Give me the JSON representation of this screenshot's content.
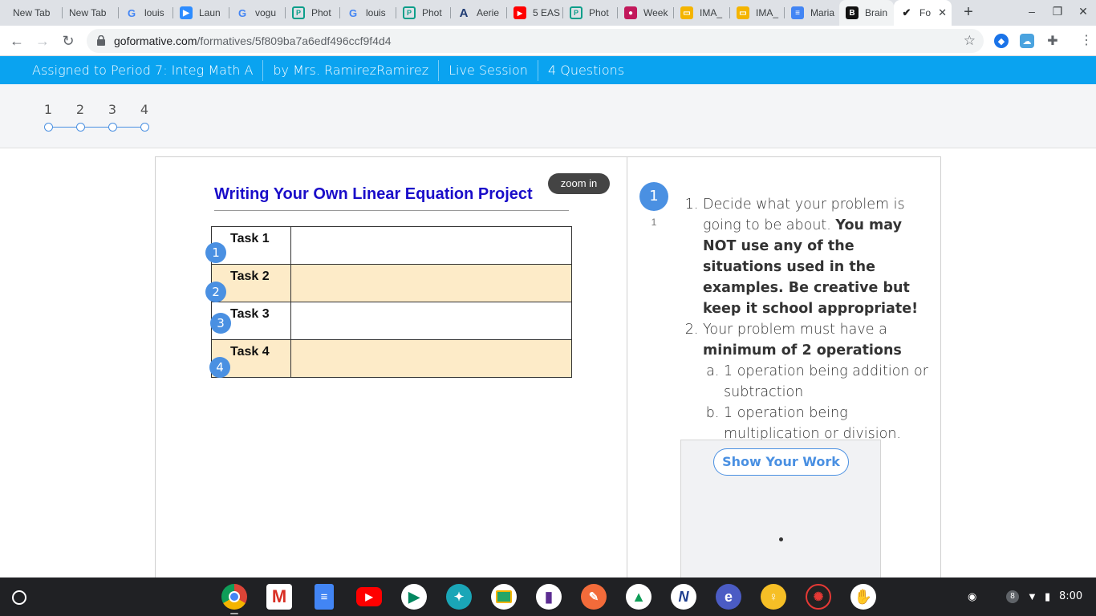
{
  "browser": {
    "tabs": [
      {
        "label": "New Tab",
        "icon": "none"
      },
      {
        "label": "New Tab",
        "icon": "none"
      },
      {
        "label": "louis",
        "icon": "google-icon"
      },
      {
        "label": "Laun",
        "icon": "zoom-icon"
      },
      {
        "label": "vogu",
        "icon": "google-icon"
      },
      {
        "label": "Phot",
        "icon": "photomath-icon"
      },
      {
        "label": "louis",
        "icon": "google-icon"
      },
      {
        "label": "Phot",
        "icon": "photomath-icon"
      },
      {
        "label": "Aerie",
        "icon": "aerie-icon"
      },
      {
        "label": "5 EAS",
        "icon": "youtube-icon"
      },
      {
        "label": "Phot",
        "icon": "photomath-icon"
      },
      {
        "label": "Week",
        "icon": "classroom-icon"
      },
      {
        "label": "IMA_",
        "icon": "slides-icon"
      },
      {
        "label": "IMA_",
        "icon": "slides-icon"
      },
      {
        "label": "Maria",
        "icon": "docs-icon"
      },
      {
        "label": "Brain",
        "icon": "brainly-icon"
      },
      {
        "label": "Fo",
        "icon": "formative-icon"
      }
    ],
    "url_host": "goformative.com",
    "url_path": "/formatives/5f809ba7a6edf496ccf9f4d4"
  },
  "header": {
    "segments": [
      "Assigned to Period 7: Integ Math A",
      "by Mrs. RamirezRamirez",
      "Live Session",
      "4 Questions"
    ]
  },
  "question_nav": {
    "numbers": [
      "1",
      "2",
      "3",
      "4"
    ]
  },
  "document": {
    "zoom_label": "zoom in",
    "title": "Writing Your Own Linear Equation Project",
    "tasks": [
      "Task 1",
      "Task 2",
      "Task 3",
      "Task 4"
    ],
    "markers": [
      "1",
      "2",
      "3",
      "4"
    ]
  },
  "question": {
    "number": "1",
    "points": "1",
    "item1_plain": "Decide what your problem is going to be about. ",
    "item1_bold": "You may NOT use any of the situations used in the examples. Be creative but keep it school appropriate!",
    "item2_plain": "Your problem must have a ",
    "item2_bold": "minimum of 2 operations",
    "sub_a": "1 operation being addition or subtraction",
    "sub_b": "1 operation being multiplication or division.",
    "show_work_label": "Show Your Work"
  },
  "shelf": {
    "apps": [
      "chrome-icon",
      "gmail-icon",
      "docs-icon",
      "youtube-icon",
      "play-store-icon",
      "app-icon",
      "classroom-icon",
      "app-icon",
      "pencil-app-icon",
      "drive-icon",
      "app-icon",
      "app-icon",
      "keep-icon",
      "app-icon",
      "app-icon"
    ],
    "notification_count": "8",
    "time": "8:00"
  },
  "colors": {
    "accent_blue": "#0aa3f0",
    "marker_blue": "#4a90e2",
    "task_tint": "#fdebc8",
    "title_blue": "#1a0dc9"
  }
}
